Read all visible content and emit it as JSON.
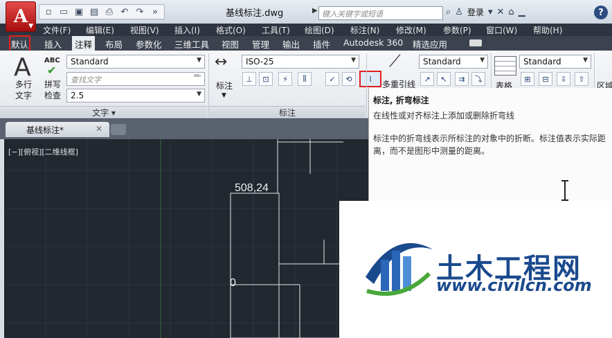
{
  "title_bar": {
    "app_letter": "A",
    "document_title": "基线标注.dwg",
    "search_placeholder": "键入关键字或短语",
    "login_label": "登录",
    "help_label": "?"
  },
  "menu": [
    "文件(F)",
    "编辑(E)",
    "视图(V)",
    "插入(I)",
    "格式(O)",
    "工具(T)",
    "绘图(D)",
    "标注(N)",
    "修改(M)",
    "参数(P)",
    "窗口(W)",
    "帮助(H)"
  ],
  "tabs": [
    "默认",
    "插入",
    "注释",
    "布局",
    "参数化",
    "三维工具",
    "视图",
    "管理",
    "输出",
    "插件",
    "Autodesk 360",
    "精选应用"
  ],
  "active_tab": "注释",
  "highlighted_tab": "默认",
  "text_panel": {
    "multiline_text_label_1": "多行",
    "multiline_text_label_2": "文字",
    "spell_abc": "ABC",
    "spell_label_1": "拼写",
    "spell_label_2": "检查",
    "text_style": "Standard",
    "find_text_placeholder": "查找文字",
    "text_height": "2.5",
    "footer": "文字 ▾"
  },
  "dim_panel": {
    "dim_label": "标注",
    "dim_style": "ISO-25",
    "footer": "标注"
  },
  "leader_panel": {
    "multileader_label": "多重引线",
    "style": "Standard"
  },
  "table_panel": {
    "table_label": "表格",
    "style": "Standard"
  },
  "region_label": "区域",
  "doc_tab": "基线标注*",
  "viewport_label": "[−][俯视][二维线框]",
  "drawing": {
    "dim_text_1": "508,24",
    "dim_text_2": "0"
  },
  "tooltip": {
    "title": "标注, 折弯标注",
    "description": "在线性或对齐标注上添加或删除折弯线",
    "body": "标注中的折弯线表示所标注的对象中的折断。标注值表示实际距离，而不是图形中测量的距离。"
  },
  "watermark": {
    "name": "土木工程网",
    "url": "www.civilcn.com"
  },
  "colors": {
    "canvas": "#212830",
    "highlight": "#e02020",
    "watermark": "#1a4a8e"
  }
}
